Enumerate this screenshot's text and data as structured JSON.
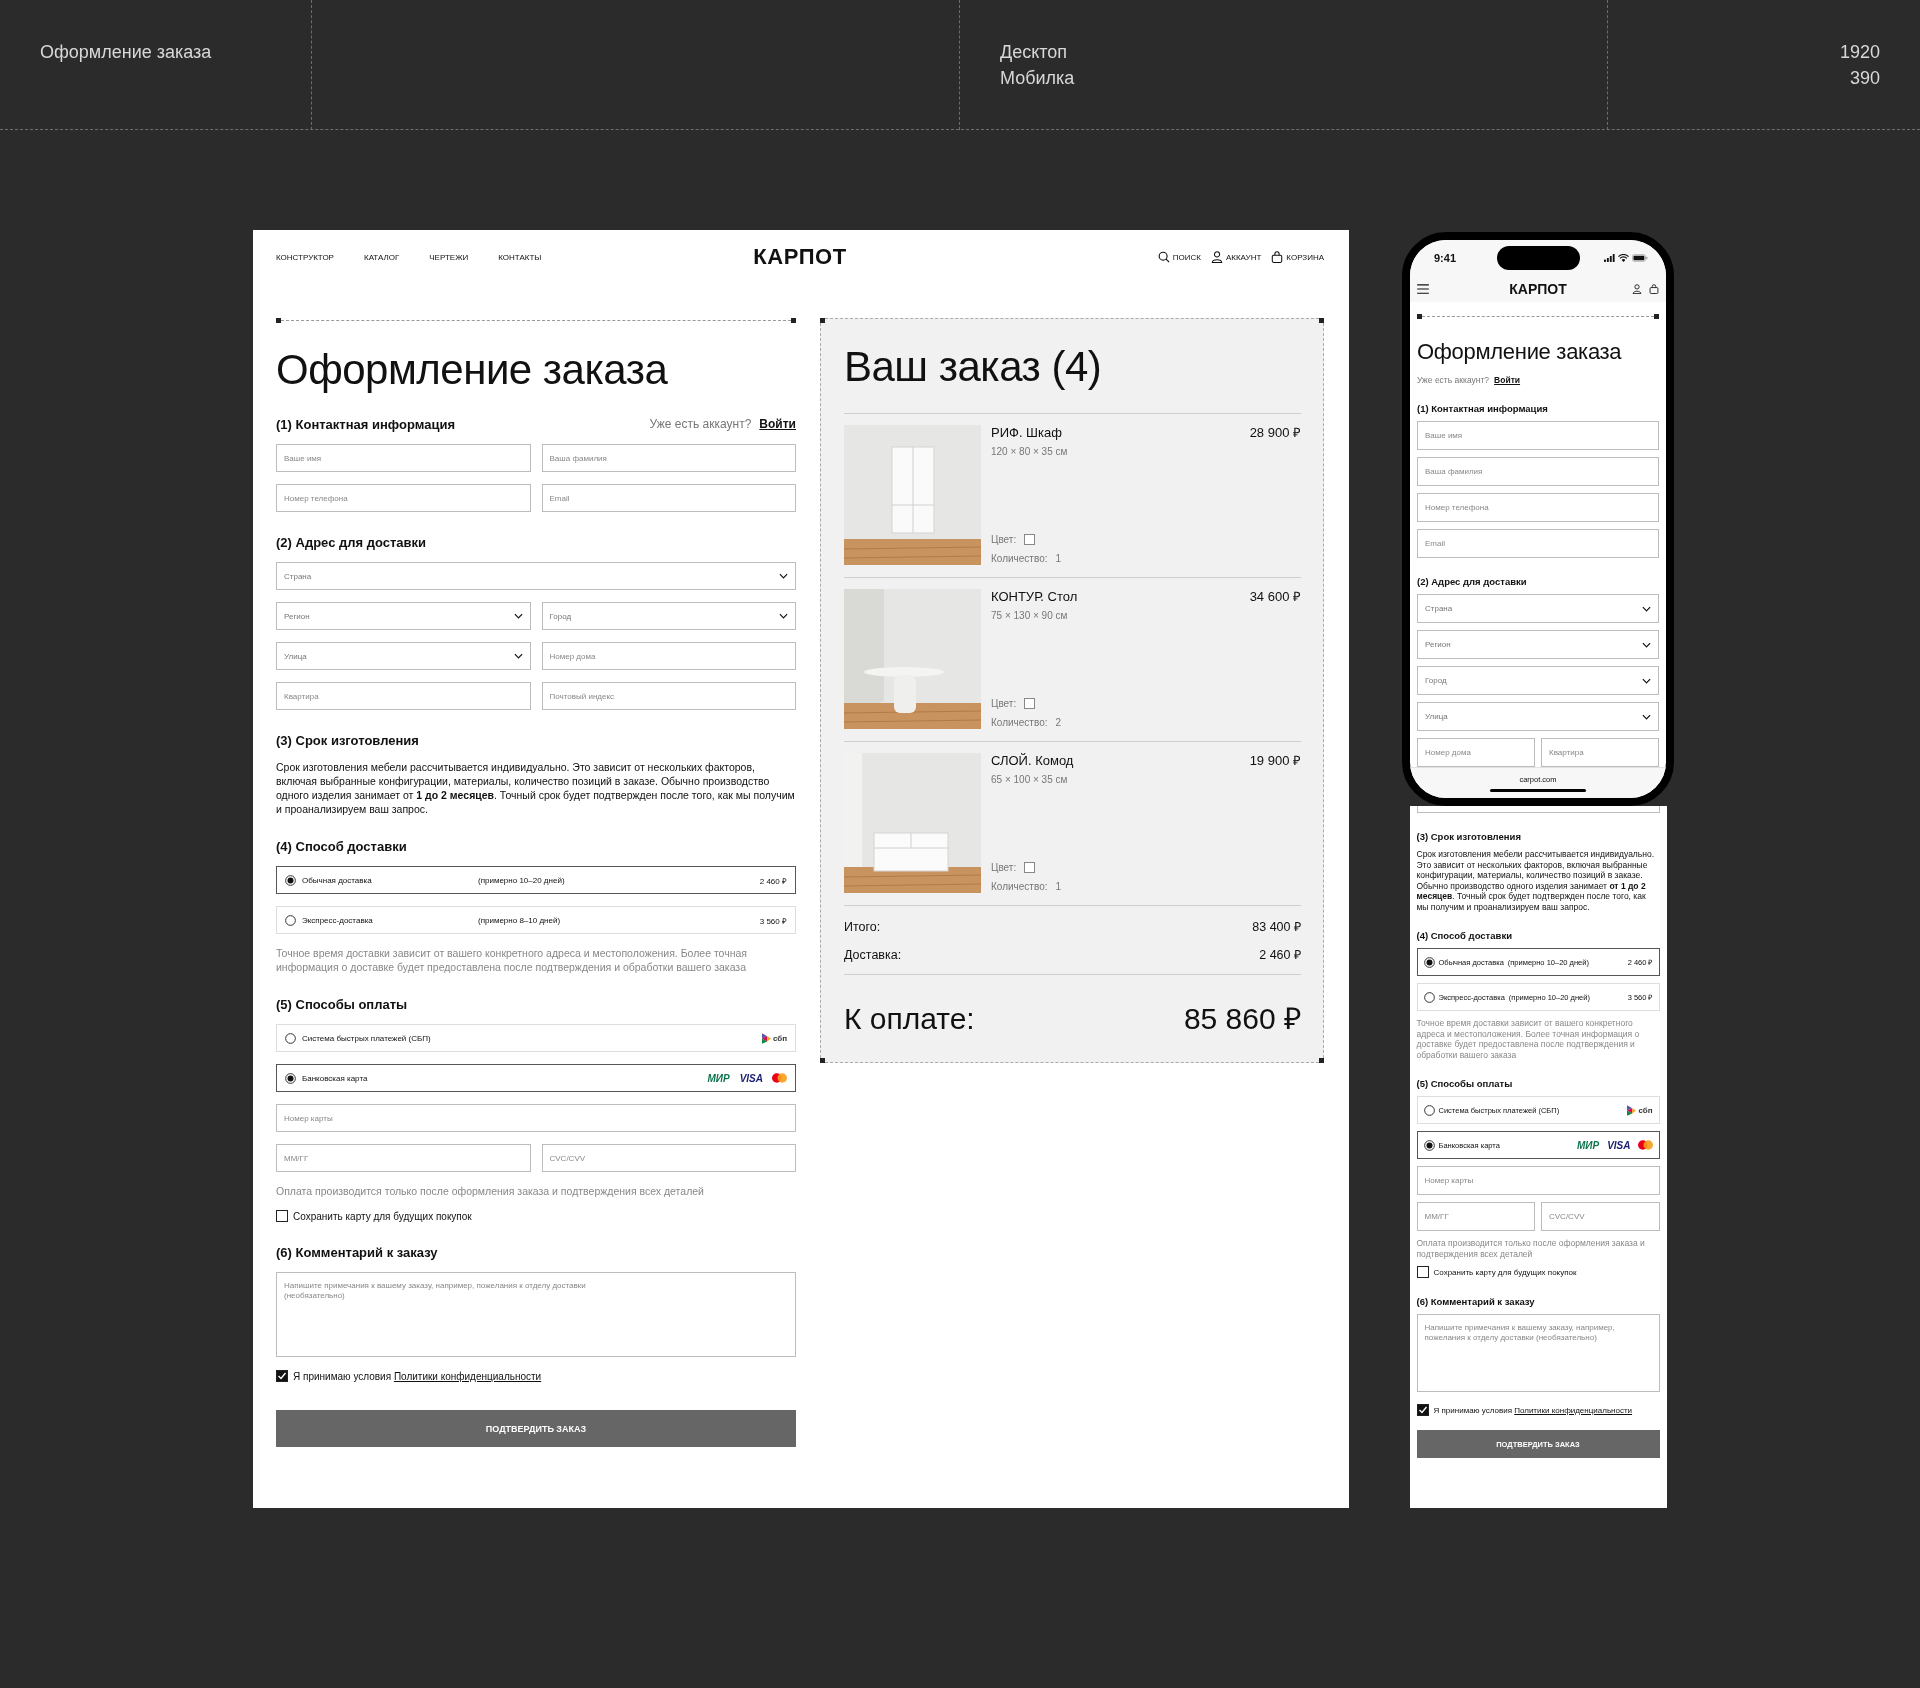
{
  "header": {
    "title": "Оформление заказа",
    "breakpoints": [
      "Десктоп",
      "Мобилка"
    ],
    "widths": [
      "1920",
      "390"
    ]
  },
  "desktop": {
    "nav": [
      "КОНСТРУКТОР",
      "КАТАЛОГ",
      "ЧЕРТЕЖИ",
      "КОНТАКТЫ"
    ],
    "logo": "КАРПОТ",
    "actions": [
      {
        "kind": "search",
        "label": "ПОИСК"
      },
      {
        "kind": "account",
        "label": "АККАУНТ"
      },
      {
        "kind": "cart",
        "label": "КОРЗИНА"
      }
    ],
    "form": {
      "title": "Оформление заказа",
      "sections": [
        {
          "heading": "(1) Контактная информация",
          "account_prompt": "Уже есть аккаунт?",
          "login": "Войти",
          "rows": [
            [
              {
                "kind": "input",
                "placeholder": "Ваше имя"
              },
              {
                "kind": "input",
                "placeholder": "Ваша фамилия"
              }
            ],
            [
              {
                "kind": "input",
                "placeholder": "Номер телефона"
              },
              {
                "kind": "input",
                "placeholder": "Email"
              }
            ]
          ]
        },
        {
          "heading": "(2) Адрес для доставки",
          "rows": [
            [
              {
                "kind": "select",
                "placeholder": "Страна"
              }
            ],
            [
              {
                "kind": "select",
                "placeholder": "Регион"
              },
              {
                "kind": "select",
                "placeholder": "Город"
              }
            ],
            [
              {
                "kind": "select",
                "placeholder": "Улица"
              },
              {
                "kind": "input",
                "placeholder": "Номер дома"
              }
            ],
            [
              {
                "kind": "input",
                "placeholder": "Квартира"
              },
              {
                "kind": "input",
                "placeholder": "Почтовый индекс"
              }
            ]
          ]
        },
        {
          "heading": "(3) Срок изготовления",
          "text": "Срок изготовления мебели рассчитывается индивидуально. Это зависит от нескольких факторов, включая выбранные конфигурации, материалы, количество позиций в заказе. Обычно производство одного изделия занимает от **1 до 2 месяцев**. Точный срок будет подтвержден после того, как мы получим и проанализируем ваш запрос."
        },
        {
          "heading": "(4) Способ доставки",
          "options": [
            {
              "label": "Обычная доставка",
              "term": "(примерно 10–20 дней)",
              "price": "2 460 ₽",
              "selected": true
            },
            {
              "label": "Экспресс-доставка",
              "term": "(примерно 8–10 дней)",
              "price": "3 560 ₽",
              "selected": false
            }
          ],
          "note": "Точное время доставки зависит от вашего конкретного адреса и местоположения. Более точная информация о доставке будет предоставлена после подтверждения и обработки вашего заказа"
        },
        {
          "heading": "(5) Способы оплаты",
          "options": [
            {
              "label": "Система быстрых платежей (СБП)",
              "brands": [
                {
                  "kind": "sbp",
                  "label": "сбп"
                }
              ],
              "selected": false
            },
            {
              "label": "Банковская карта",
              "brands": [
                {
                  "kind": "mir",
                  "label": "МИР"
                },
                {
                  "kind": "visa",
                  "label": "VISA"
                },
                {
                  "kind": "mastercard"
                }
              ],
              "selected": true
            }
          ],
          "rows": [
            [
              {
                "kind": "input",
                "placeholder": "Номер карты"
              }
            ],
            [
              {
                "kind": "input",
                "placeholder": "ММ/ГГ"
              },
              {
                "kind": "input",
                "placeholder": "CVC/CVV"
              }
            ]
          ],
          "note": "Оплата производится только после оформления заказа и подтверждения всех деталей",
          "save_card": {
            "label": "Сохранить карту для будущих покупок",
            "checked": false
          }
        },
        {
          "heading": "(6) Комментарий к заказу",
          "comment_placeholder": "Напишите примечания к вашему заказу, например, пожелания к отделу доставки\n(необязательно)"
        }
      ],
      "consent": {
        "checked": true,
        "text": "Я принимаю условия",
        "link": "Политики конфиденциальности"
      },
      "submit": "ПОДТВЕРДИТЬ ЗАКАЗ"
    },
    "order": {
      "title": "Ваш заказ (4)",
      "items": [
        {
          "name": "РИФ. Шкаф",
          "dimensions": "120 × 80 × 35 см",
          "price": "28 900 ₽",
          "color_label": "Цвет:",
          "quantity_label": "Количество:",
          "quantity": "1"
        },
        {
          "name": "КОНТУР. Стол",
          "dimensions": "75 × 130 × 90 см",
          "price": "34 600 ₽",
          "color_label": "Цвет:",
          "quantity_label": "Количество:",
          "quantity": "2"
        },
        {
          "name": "СЛОЙ. Комод",
          "dimensions": "65 × 100 × 35 см",
          "price": "19 900 ₽",
          "color_label": "Цвет:",
          "quantity_label": "Количество:",
          "quantity": "1"
        }
      ],
      "totals": [
        {
          "label": "Итого:",
          "value": "83 400 ₽"
        },
        {
          "label": "Доставка:",
          "value": "2 460 ₽"
        }
      ],
      "due": {
        "label": "К оплате:",
        "value": "85 860 ₽"
      }
    }
  },
  "mobile": {
    "status_time": "9:41",
    "logo": "КАРПОТ",
    "form": {
      "title": "Оформление заказа",
      "account_prompt": "Уже есть аккаунт?",
      "login": "Войти",
      "sections": [
        {
          "heading": "(1) Контактная информация",
          "rows": [
            [
              {
                "kind": "input",
                "placeholder": "Ваше имя"
              }
            ],
            [
              {
                "kind": "input",
                "placeholder": "Ваша фамилия"
              }
            ],
            [
              {
                "kind": "input",
                "placeholder": "Номер телефона"
              }
            ],
            [
              {
                "kind": "input",
                "placeholder": "Email"
              }
            ]
          ]
        },
        {
          "heading": "(2) Адрес для доставки",
          "rows": [
            [
              {
                "kind": "select",
                "placeholder": "Страна"
              }
            ],
            [
              {
                "kind": "select",
                "placeholder": "Регион"
              }
            ],
            [
              {
                "kind": "select",
                "placeholder": "Город"
              }
            ],
            [
              {
                "kind": "select",
                "placeholder": "Улица"
              }
            ],
            [
              {
                "kind": "input",
                "placeholder": "Номер дома"
              },
              {
                "kind": "input",
                "placeholder": "Квартира"
              }
            ]
          ]
        }
      ]
    },
    "url": "carpot.com",
    "continued": {
      "sections": [
        {
          "heading": "(3) Срок изготовления",
          "text": "Срок изготовления мебели рассчитывается индивидуально. Это зависит от нескольких факторов, включая выбранные конфигурации, материалы, количество позиций в заказе. Обычно производство одного изделия занимает **от 1 до 2 месяцев**. Точный срок будет подтвержден после того, как мы получим и проанализируем ваш запрос."
        },
        {
          "heading": "(4) Способ доставки",
          "options": [
            {
              "label": "Обычная доставка",
              "term": "(примерно 10–20 дней)",
              "price": "2 460 ₽",
              "selected": true
            },
            {
              "label": "Экспресс-доставка",
              "term": "(примерно 10–20 дней)",
              "price": "3 560 ₽",
              "selected": false
            }
          ],
          "note": "Точное время доставки зависит от вашего конкретного адреса и местоположения. Более точная информация о доставке будет предоставлена после подтверждения и обработки вашего заказа"
        },
        {
          "heading": "(5) Способы оплаты",
          "options": [
            {
              "label": "Система быстрых платежей (СБП)",
              "brands": [
                {
                  "kind": "sbp",
                  "label": "сбп"
                }
              ],
              "selected": false
            },
            {
              "label": "Банковская карта",
              "brands": [
                {
                  "kind": "mir",
                  "label": "МИР"
                },
                {
                  "kind": "visa",
                  "label": "VISA"
                },
                {
                  "kind": "mastercard"
                }
              ],
              "selected": true
            }
          ],
          "rows": [
            [
              {
                "kind": "input",
                "placeholder": "Номер карты"
              }
            ],
            [
              {
                "kind": "input",
                "placeholder": "ММ/ГГ"
              },
              {
                "kind": "input",
                "placeholder": "CVC/CVV"
              }
            ]
          ],
          "note": "Оплата производится только после оформления заказа и подтверждения всех деталей",
          "save_card": {
            "label": "Сохранить карту для будущих покупок",
            "checked": false
          }
        },
        {
          "heading": "(6) Комментарий к заказу",
          "comment_placeholder": "Напишите примечания к вашему заказу, например, пожелания к отделу доставки (необязательно)"
        }
      ],
      "consent": {
        "checked": true,
        "text": "Я принимаю условия",
        "link": "Политики конфиденциальности"
      },
      "submit": "ПОДТВЕРДИТЬ ЗАКАЗ"
    }
  }
}
